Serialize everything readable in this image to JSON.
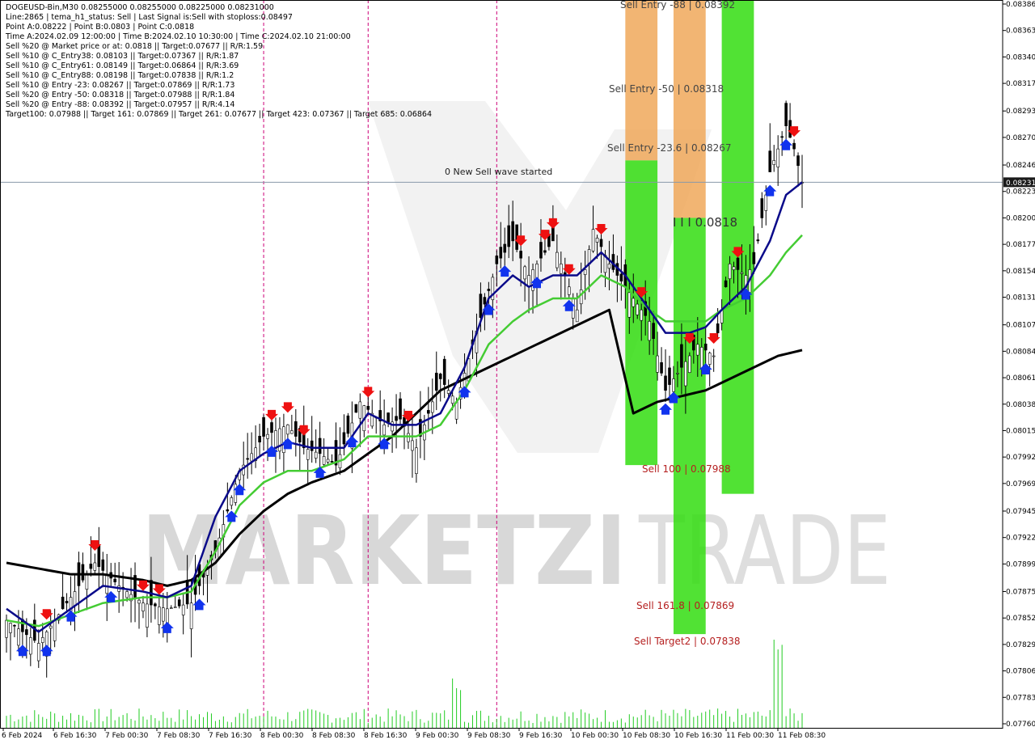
{
  "info": {
    "lines": [
      "DOGEUSD-Bin,M30  0.08255000 0.08255000 0.08225000 0.08231000",
      "Line:2865 | tema_h1_status: Sell | Last Signal is:Sell with stoploss:0.08497",
      "Point A:0.08222 | Point B:0.0803 | Point C:0.0818",
      "Time A:2024.02.09 12:00:00 | Time B:2024.02.10 10:30:00 | Time C:2024.02.10 21:00:00",
      "Sell %20 @ Market price or at: 0.0818 || Target:0.07677 || R/R:1.59",
      "Sell %10 @ C_Entry38: 0.08103 || Target:0.07367 || R/R:1.87",
      "Sell %10 @ C_Entry61: 0.08149 || Target:0.06864 || R/R:3.69",
      "Sell %10 @ C_Entry88: 0.08198 || Target:0.07838 || R/R:1.2",
      "Sell %10 @ Entry -23: 0.08267 || Target:0.07869 || R/R:1.73",
      "Sell %20 @ Entry -50: 0.08318 || Target:0.07988 || R/R:1.84",
      "Sell %20 @ Entry -88: 0.08392 || Target:0.07957 || R/R:4.14",
      "Target100: 0.07988 || Target 161: 0.07869 || Target 261: 0.07677 || Target 423: 0.07367 || Target 685: 0.06864"
    ]
  },
  "watermark": {
    "text_left": "MARKETZI",
    "text_right": "TRADE"
  },
  "annotations": {
    "sell_entry_88": "Sell Entry -88 | 0.08392",
    "sell_entry_50": "Sell Entry -50 | 0.08318",
    "sell_entry_23": "Sell Entry -23.6 | 0.08267",
    "new_wave": "0 New Sell wave started",
    "point_c": "I I I 0.0818",
    "sell_100": "Sell 100 | 0.07988",
    "sell_161": "Sell 161.8 | 0.07869",
    "sell_target2": "Sell Target2 | 0.07838"
  },
  "current_price_label": "0.08231",
  "colors": {
    "orange_zone": "#f0a85a",
    "green_zone": "#33dd11",
    "ema_fast": "#0a0a8a",
    "ema_mid": "#44cc33",
    "ema_slow": "#000000",
    "sell_arrow": "#ee1111",
    "buy_arrow": "#1133ee",
    "session_line": "#cc0077",
    "annot_red": "#b52020"
  },
  "chart_data": {
    "type": "candlestick",
    "symbol": "DOGEUSD-Bin",
    "timeframe": "M30",
    "ylim": [
      0.0776,
      0.08386
    ],
    "y_ticks": [
      0.08386,
      0.08363,
      0.0834,
      0.08317,
      0.08293,
      0.0827,
      0.08246,
      0.08223,
      0.082,
      0.08177,
      0.08154,
      0.08131,
      0.08107,
      0.08084,
      0.08061,
      0.08038,
      0.08015,
      0.07992,
      0.07969,
      0.07945,
      0.07922,
      0.07899,
      0.07875,
      0.07852,
      0.07829,
      0.07806,
      0.07783,
      0.0776
    ],
    "x_tick_labels": [
      "6 Feb 2024",
      "6 Feb 16:30",
      "7 Feb 00:30",
      "7 Feb 08:30",
      "7 Feb 16:30",
      "8 Feb 00:30",
      "8 Feb 08:30",
      "8 Feb 16:30",
      "9 Feb 00:30",
      "9 Feb 08:30",
      "9 Feb 16:30",
      "10 Feb 00:30",
      "10 Feb 08:30",
      "10 Feb 16:30",
      "11 Feb 00:30",
      "11 Feb 08:30"
    ],
    "current_price": 0.08231,
    "price_path": [
      [
        0,
        0.0785
      ],
      [
        4,
        0.0783
      ],
      [
        8,
        0.0787
      ],
      [
        11,
        0.079
      ],
      [
        14,
        0.0788
      ],
      [
        17,
        0.07865
      ],
      [
        20,
        0.0786
      ],
      [
        23,
        0.07865
      ],
      [
        26,
        0.0791
      ],
      [
        29,
        0.0798
      ],
      [
        32,
        0.0801
      ],
      [
        35,
        0.0802
      ],
      [
        37,
        0.08
      ],
      [
        39,
        0.07995
      ],
      [
        41,
        0.07985
      ],
      [
        44,
        0.0804
      ],
      [
        47,
        0.0802
      ],
      [
        49,
        0.08025
      ],
      [
        51,
        0.08
      ],
      [
        54,
        0.0806
      ],
      [
        56,
        0.0804
      ],
      [
        58,
        0.0809
      ],
      [
        61,
        0.0816
      ],
      [
        63,
        0.0818
      ],
      [
        65,
        0.0815
      ],
      [
        68,
        0.0818
      ],
      [
        71,
        0.0812
      ],
      [
        73,
        0.0819
      ],
      [
        75,
        0.0816
      ],
      [
        77,
        0.0814
      ],
      [
        80,
        0.0811
      ],
      [
        82,
        0.0805
      ],
      [
        84,
        0.0807
      ],
      [
        86,
        0.0809
      ],
      [
        88,
        0.0808
      ],
      [
        90,
        0.0816
      ],
      [
        92,
        0.0815
      ],
      [
        93,
        0.0816
      ],
      [
        95,
        0.0824
      ],
      [
        97,
        0.0828
      ],
      [
        98,
        0.0826
      ],
      [
        99,
        0.08231
      ]
    ],
    "ema_fast": [
      [
        0,
        0.0786
      ],
      [
        4,
        0.0784
      ],
      [
        8,
        0.0786
      ],
      [
        12,
        0.0788
      ],
      [
        17,
        0.07875
      ],
      [
        20,
        0.0787
      ],
      [
        23,
        0.0788
      ],
      [
        26,
        0.0794
      ],
      [
        29,
        0.0798
      ],
      [
        32,
        0.07995
      ],
      [
        35,
        0.08005
      ],
      [
        38,
        0.08
      ],
      [
        42,
        0.08
      ],
      [
        45,
        0.0803
      ],
      [
        48,
        0.0802
      ],
      [
        51,
        0.0802
      ],
      [
        54,
        0.0803
      ],
      [
        57,
        0.0807
      ],
      [
        60,
        0.0813
      ],
      [
        63,
        0.0815
      ],
      [
        65,
        0.0814
      ],
      [
        68,
        0.0815
      ],
      [
        71,
        0.0815
      ],
      [
        74,
        0.0817
      ],
      [
        77,
        0.0815
      ],
      [
        80,
        0.0812
      ],
      [
        82,
        0.081
      ],
      [
        85,
        0.081
      ],
      [
        87,
        0.08105
      ],
      [
        89,
        0.0812
      ],
      [
        92,
        0.0814
      ],
      [
        95,
        0.0818
      ],
      [
        97,
        0.0822
      ],
      [
        99,
        0.08231
      ]
    ],
    "ema_mid": [
      [
        0,
        0.0785
      ],
      [
        4,
        0.07845
      ],
      [
        8,
        0.07855
      ],
      [
        12,
        0.07865
      ],
      [
        17,
        0.0787
      ],
      [
        20,
        0.0787
      ],
      [
        23,
        0.07875
      ],
      [
        26,
        0.0791
      ],
      [
        29,
        0.0795
      ],
      [
        32,
        0.0797
      ],
      [
        35,
        0.0798
      ],
      [
        38,
        0.0798
      ],
      [
        42,
        0.0799
      ],
      [
        45,
        0.0801
      ],
      [
        48,
        0.0801
      ],
      [
        51,
        0.0801
      ],
      [
        54,
        0.0802
      ],
      [
        57,
        0.0805
      ],
      [
        60,
        0.0809
      ],
      [
        63,
        0.0811
      ],
      [
        65,
        0.0812
      ],
      [
        68,
        0.0813
      ],
      [
        71,
        0.0813
      ],
      [
        74,
        0.0815
      ],
      [
        77,
        0.0814
      ],
      [
        80,
        0.0812
      ],
      [
        82,
        0.0811
      ],
      [
        85,
        0.0811
      ],
      [
        87,
        0.0811
      ],
      [
        89,
        0.0812
      ],
      [
        92,
        0.0813
      ],
      [
        95,
        0.0815
      ],
      [
        97,
        0.0817
      ],
      [
        99,
        0.08185
      ]
    ],
    "ema_slow": [
      [
        0,
        0.079
      ],
      [
        4,
        0.07895
      ],
      [
        8,
        0.0789
      ],
      [
        12,
        0.0789
      ],
      [
        17,
        0.07885
      ],
      [
        20,
        0.0788
      ],
      [
        23,
        0.07885
      ],
      [
        26,
        0.079
      ],
      [
        29,
        0.07925
      ],
      [
        32,
        0.07945
      ],
      [
        35,
        0.0796
      ],
      [
        38,
        0.0797
      ],
      [
        42,
        0.0798
      ],
      [
        45,
        0.07995
      ],
      [
        48,
        0.0801
      ],
      [
        51,
        0.0803
      ],
      [
        54,
        0.0805
      ],
      [
        57,
        0.0806
      ],
      [
        60,
        0.0807
      ],
      [
        63,
        0.0808
      ],
      [
        66,
        0.0809
      ],
      [
        69,
        0.081
      ],
      [
        72,
        0.0811
      ],
      [
        75,
        0.0812
      ],
      [
        78,
        0.0803
      ],
      [
        81,
        0.0804
      ],
      [
        84,
        0.08045
      ],
      [
        87,
        0.0805
      ],
      [
        90,
        0.0806
      ],
      [
        93,
        0.0807
      ],
      [
        96,
        0.0808
      ],
      [
        99,
        0.08085
      ]
    ],
    "zones": [
      {
        "type": "orange",
        "x0": 77,
        "x1": 81,
        "y0": 0.0839,
        "y1": 0.0825
      },
      {
        "type": "green",
        "x0": 77,
        "x1": 81,
        "y0": 0.0825,
        "y1": 0.07985
      },
      {
        "type": "orange",
        "x0": 83,
        "x1": 87,
        "y0": 0.0839,
        "y1": 0.082
      },
      {
        "type": "green",
        "x0": 83,
        "x1": 87,
        "y0": 0.082,
        "y1": 0.07838
      },
      {
        "type": "green",
        "x0": 89,
        "x1": 93,
        "y0": 0.0839,
        "y1": 0.0796
      }
    ],
    "session_lines_x": [
      32,
      45,
      61
    ],
    "sell_arrows_x": [
      5,
      11,
      17,
      19,
      33,
      35,
      37,
      45,
      50,
      64,
      67,
      68,
      70,
      74,
      79,
      85,
      88,
      91,
      98
    ],
    "buy_arrows_x": [
      2,
      5,
      8,
      13,
      20,
      24,
      28,
      29,
      33,
      35,
      39,
      43,
      47,
      57,
      60,
      62,
      66,
      70,
      82,
      83,
      87,
      92,
      95,
      97
    ]
  }
}
